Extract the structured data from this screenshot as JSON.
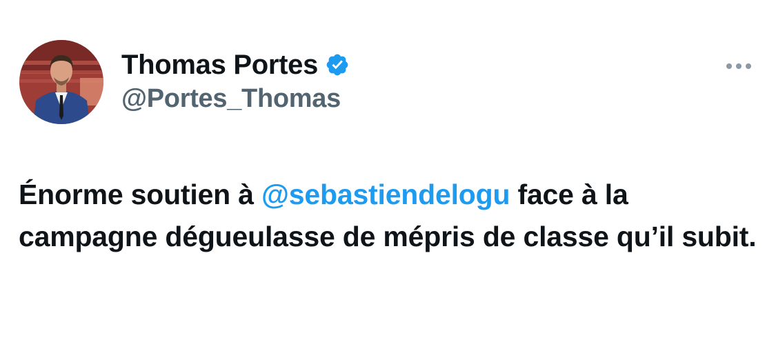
{
  "tweet": {
    "author": {
      "display_name": "Thomas Portes",
      "handle": "@Portes_Thomas",
      "verified": true
    },
    "text": {
      "part1": "Énorme soutien à ",
      "mention": "@sebastiendelogu",
      "part2": " face à la campagne dégueulasse de mépris de classe qu’il subit."
    }
  },
  "colors": {
    "accent": "#1d9bf0",
    "text_primary": "#0f1419",
    "text_secondary": "#536471"
  },
  "icons": {
    "verified": "verified-badge-icon",
    "more": "more-options-icon"
  }
}
